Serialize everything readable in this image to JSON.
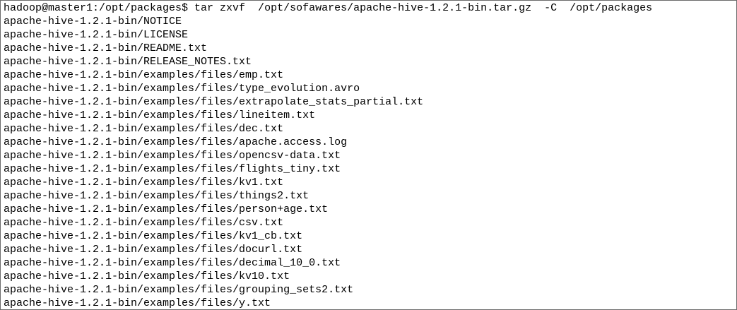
{
  "terminal": {
    "prompt": "hadoop@master1:/opt/packages$ ",
    "command": "tar zxvf  /opt/sofawares/apache-hive-1.2.1-bin.tar.gz  -C  /opt/packages",
    "output_lines": [
      "apache-hive-1.2.1-bin/NOTICE",
      "apache-hive-1.2.1-bin/LICENSE",
      "apache-hive-1.2.1-bin/README.txt",
      "apache-hive-1.2.1-bin/RELEASE_NOTES.txt",
      "apache-hive-1.2.1-bin/examples/files/emp.txt",
      "apache-hive-1.2.1-bin/examples/files/type_evolution.avro",
      "apache-hive-1.2.1-bin/examples/files/extrapolate_stats_partial.txt",
      "apache-hive-1.2.1-bin/examples/files/lineitem.txt",
      "apache-hive-1.2.1-bin/examples/files/dec.txt",
      "apache-hive-1.2.1-bin/examples/files/apache.access.log",
      "apache-hive-1.2.1-bin/examples/files/opencsv-data.txt",
      "apache-hive-1.2.1-bin/examples/files/flights_tiny.txt",
      "apache-hive-1.2.1-bin/examples/files/kv1.txt",
      "apache-hive-1.2.1-bin/examples/files/things2.txt",
      "apache-hive-1.2.1-bin/examples/files/person+age.txt",
      "apache-hive-1.2.1-bin/examples/files/csv.txt",
      "apache-hive-1.2.1-bin/examples/files/kv1_cb.txt",
      "apache-hive-1.2.1-bin/examples/files/docurl.txt",
      "apache-hive-1.2.1-bin/examples/files/decimal_10_0.txt",
      "apache-hive-1.2.1-bin/examples/files/kv10.txt",
      "apache-hive-1.2.1-bin/examples/files/grouping_sets2.txt",
      "apache-hive-1.2.1-bin/examples/files/y.txt"
    ]
  }
}
